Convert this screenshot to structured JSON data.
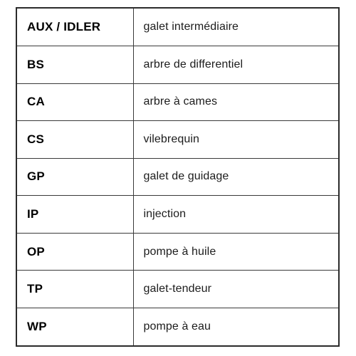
{
  "page": {
    "background_color": "#ffffff",
    "border_color": "#2b2b2b",
    "rule_color": "#3a3a3a",
    "text_color": "#000000"
  },
  "table": {
    "columns": [
      {
        "key": "abbr",
        "header": ""
      },
      {
        "key": "description",
        "header": ""
      }
    ],
    "rows": [
      {
        "abbr": "AUX / IDLER",
        "description": "galet intermédiaire",
        "group": 1
      },
      {
        "abbr": "BS",
        "description": "arbre de differentiel",
        "group": 1
      },
      {
        "abbr": "CA",
        "description": "arbre à cames",
        "group": 1
      },
      {
        "abbr": "CS",
        "description": "vilebrequin",
        "group": 2
      },
      {
        "abbr": "GP",
        "description": "galet de guidage",
        "group": 2
      },
      {
        "abbr": "IP",
        "description": "injection",
        "group": 2
      },
      {
        "abbr": "OP",
        "description": "pompe à huile",
        "group": 3
      },
      {
        "abbr": "TP",
        "description": "galet-tendeur",
        "group": 3
      },
      {
        "abbr": "WP",
        "description": "pompe à eau",
        "group": 3
      }
    ]
  }
}
